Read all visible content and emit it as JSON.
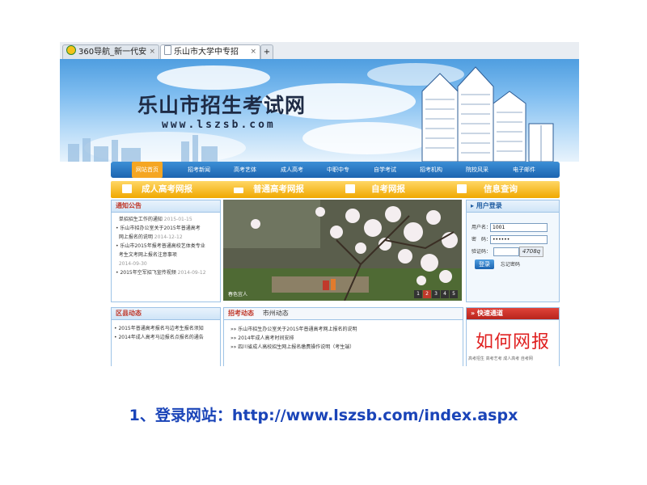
{
  "browser": {
    "tabs": [
      {
        "label": "360导航_新一代安",
        "icon": "360-browser-icon",
        "active": false
      },
      {
        "label": "乐山市大学中专招",
        "icon": "page-icon",
        "active": true
      }
    ],
    "close_glyph": "×",
    "new_tab_glyph": "+"
  },
  "banner": {
    "title": "乐山市招生考试网",
    "url": "www.lszsb.com"
  },
  "nav": {
    "items": [
      "网站首页",
      "招考新闻",
      "高考艺体",
      "成人高考",
      "中职中专",
      "自学考试",
      "招考机构",
      "院校风采",
      "电子邮件"
    ]
  },
  "quick": {
    "items": [
      "成人高考网报",
      "普通高考网报",
      "自考网报",
      "信息查询"
    ]
  },
  "notice": {
    "title": "通知公告",
    "items": [
      {
        "text": "单招招生工作的通知",
        "date": "2015-01-15"
      },
      {
        "text": "乐山市招办公室关于2015年普通高考",
        "date": ""
      },
      {
        "text": "网上报名的说明",
        "date": "2014-12-12"
      },
      {
        "text": "乐山市2015年报考普通高校艺体类专业",
        "date": ""
      },
      {
        "text": "考生文考网上报名注意事项",
        "date": ""
      },
      {
        "text": "",
        "date": "2014-09-30"
      },
      {
        "text": "2015年空军招飞宣传视频",
        "date": "2014-09-12"
      }
    ]
  },
  "slideshow": {
    "caption": "春色宜人",
    "controls": [
      "1",
      "2",
      "3",
      "4",
      "5"
    ]
  },
  "login": {
    "title": "用户登录",
    "username_label": "用户名：",
    "username_value": "1001",
    "password_label": "密　码：",
    "password_value": "••••••",
    "captcha_label": "验证码：",
    "captcha_text": "4708q",
    "login_button": "登录",
    "forgot_link": "忘记密码"
  },
  "district": {
    "title": "区县动态",
    "items": [
      "2015年普通高考报名马边考生报名须知",
      "2014年成人高考马边报名点报名的通告"
    ]
  },
  "news": {
    "tabs": [
      "招考动态",
      "市州动态"
    ],
    "items": [
      "乐山市招生办公室关于2015年普通高考网上报名的说明",
      "2014年成人高考时间安排",
      "四川省成人高校招生网上报名缴费操作说明（考生端）"
    ]
  },
  "quicklinks": {
    "title": "快速通道",
    "overlay_text": "如何网报",
    "bottom_links": [
      "高考招生",
      "高考艺考",
      "成人高考",
      "自考网"
    ]
  },
  "caption": "1、登录网站：http://www.lszsb.com/index.aspx",
  "colors": {
    "nav_blue": "#1c64b0",
    "quick_orange": "#f0a800",
    "caption_blue": "#1a44b8",
    "overlay_red": "#e02020"
  }
}
